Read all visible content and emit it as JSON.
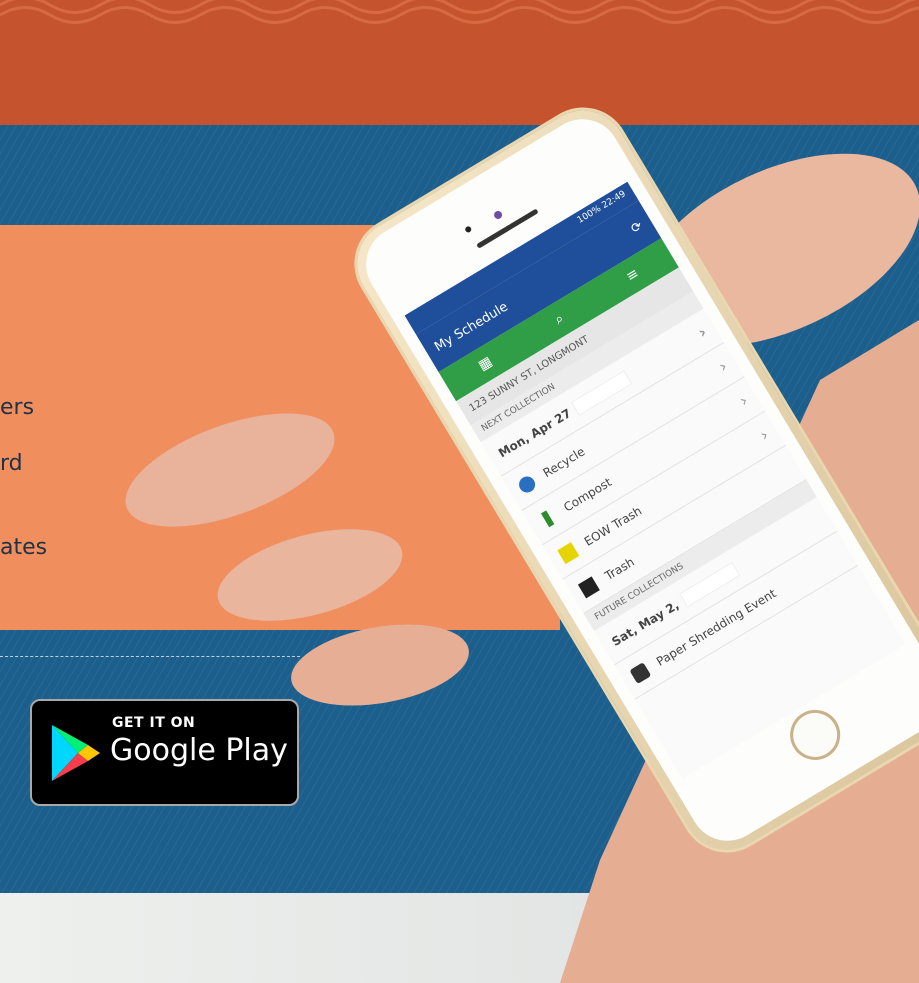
{
  "features": {
    "line1": "ers",
    "line2": "rd",
    "line3": "ates"
  },
  "store_badge": {
    "small": "GET IT ON",
    "big": "Google Play"
  },
  "phone": {
    "status": "100% 22:49",
    "app_title": "My Schedule",
    "address": "123 SUNNY ST, LONGMONT",
    "next_header": "NEXT COLLECTION",
    "next_date": "Mon, Apr 27",
    "items": [
      {
        "label": "Recycle",
        "icon": "recycle-icon",
        "color": "#2a6fc2"
      },
      {
        "label": "Compost",
        "icon": "compost-icon",
        "color": "#2e8b2e"
      },
      {
        "label": "EOW Trash",
        "icon": "eow-trash-icon",
        "color": "#e6d400"
      },
      {
        "label": "Trash",
        "icon": "trash-icon",
        "color": "#222222"
      }
    ],
    "future_header": "FUTURE COLLECTIONS",
    "future_date": "Sat, May 2,",
    "future_item": "Paper Shredding Event"
  },
  "colors": {
    "banner": "#c5532d",
    "panel": "#1c5f8d",
    "orange": "#f08e5e",
    "app_blue": "#1f4e9a",
    "app_green": "#2f9e46"
  }
}
